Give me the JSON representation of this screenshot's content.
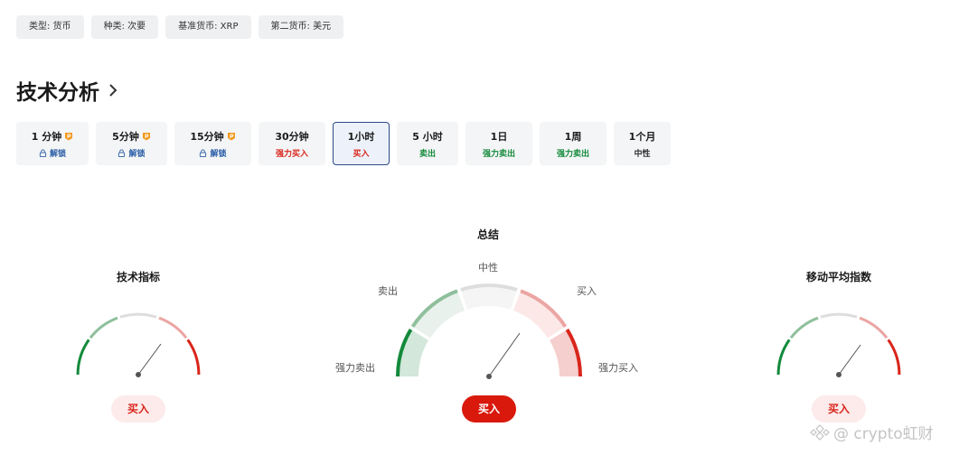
{
  "tags": [
    "类型: 货币",
    "种类: 次要",
    "基准货币: XRP",
    "第二货币: 美元"
  ],
  "section": {
    "title": "技术分析"
  },
  "timeframes": [
    {
      "label": "1 分钟",
      "status": "解锁",
      "pro": true
    },
    {
      "label": "5分钟",
      "status": "解锁",
      "pro": true
    },
    {
      "label": "15分钟",
      "status": "解锁",
      "pro": true
    },
    {
      "label": "30分钟",
      "status": "强力买入",
      "pro": false
    },
    {
      "label": "1小时",
      "status": "买入",
      "pro": false,
      "active": true
    },
    {
      "label": "5 小时",
      "status": "卖出",
      "pro": false
    },
    {
      "label": "1日",
      "status": "强力卖出",
      "pro": false
    },
    {
      "label": "1周",
      "status": "强力卖出",
      "pro": false
    },
    {
      "label": "1个月",
      "status": "中性",
      "pro": false
    }
  ],
  "gauges": {
    "indicators": {
      "title": "技术指标",
      "result": "买入"
    },
    "summary": {
      "title": "总结",
      "result": "买入",
      "labels": {
        "strong_sell": "强力卖出",
        "sell": "卖出",
        "neutral": "中性",
        "buy": "买入",
        "strong_buy": "强力买入"
      }
    },
    "moving_averages": {
      "title": "移动平均指数",
      "result": "买入"
    }
  },
  "watermark": "@ crypto虹财",
  "colors": {
    "strong_sell": "#138a3b",
    "sell": "#8fbf9c",
    "neutral": "#dddddd",
    "buy": "#eba5a3",
    "strong_buy": "#d9251c"
  }
}
